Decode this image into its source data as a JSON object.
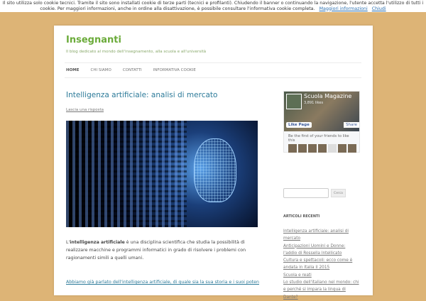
{
  "cookie_banner": {
    "text": "Il sito utilizza solo cookie tecnici. Tramite il sito sono installati cookie di terze parti (tecnici e profilanti). Chiudendo il banner o continuando la navigazione, l'utente accetta l'utilizzo di tutti i cookie. Per maggiori informazioni, anche in ordine alla disattivazione, è possibile consultare l'informativa cookie completa.",
    "more_link": "Maggiori informazioni",
    "close_link": "Chiudi"
  },
  "site": {
    "title": "Insegnanti",
    "tagline": "Il blog dedicato al mondo dell'insegnamento, alla scuola e all'università"
  },
  "nav": [
    "HOME",
    "CHI SIAMO",
    "CONTATTI",
    "INFORMATIVA COOKIE"
  ],
  "post": {
    "title": "Intelligenza artificiale: analisi di mercato",
    "reply": "Lascia una risposta",
    "intro_prefix": "L'",
    "intro_bold": "intelligenza artificiale",
    "intro_rest": " è una disciplina scientifica che studia la possibilità di realizzare macchine e programmi informatici in grado di risolvere i problemi con ragionamenti simili a quelli umani.",
    "link_text": "Abbiamo già parlato dell'intelligenza artificiale, di quale sia la sua storia e i suoi potenziali settori"
  },
  "facebook": {
    "page_name": "Scuola Magazine",
    "likes": "3,891 likes",
    "like_button": "Like Page",
    "share_button": "Share",
    "friends_text": "Be the first of your friends to like this"
  },
  "sidebar": {
    "search_button": "Cerca",
    "recent_heading": "ARTICOLI RECENTI",
    "recent": [
      "Intelligenza artificiale: analisi di mercato",
      "Anticipazioni Uomini e Donne: l'addio di Rossella Intellicato",
      "Cultura e spettacoli: ecco come è andata in Italia il 2015",
      "Scuola e reati",
      "Lo studio dell'italiano nel mondo: chi e perché si impara la lingua di Dante?"
    ]
  }
}
